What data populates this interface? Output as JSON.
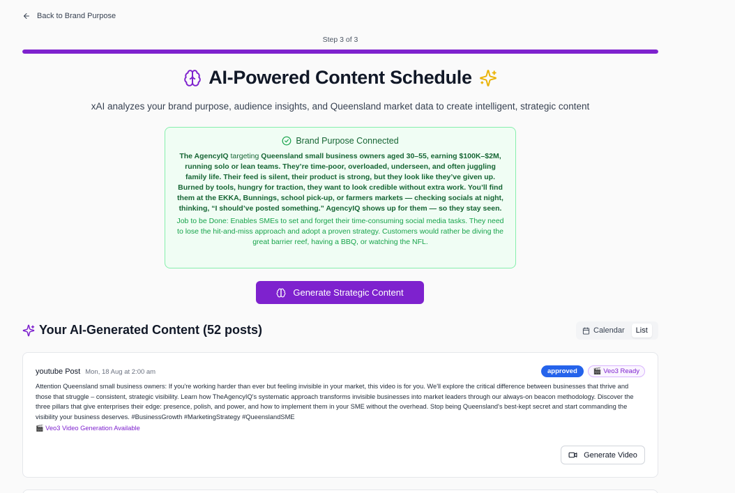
{
  "nav": {
    "back_label": "Back to Brand Purpose"
  },
  "progress": {
    "label": "Step 3 of 3",
    "fraction": 1.0,
    "color": "#7e22ce"
  },
  "hero": {
    "title": "AI-Powered Content Schedule",
    "subtitle": "xAI analyzes your brand purpose, audience insights, and Queensland market data to create intelligent, strategic content",
    "title_icon": "brain-icon",
    "sparkle_icon": "sparkles-icon"
  },
  "brand_purpose": {
    "heading": "Brand Purpose Connected",
    "brand_name": "The AgencyIQ",
    "targeting_word": "targeting",
    "audience": "Queensland small business owners aged 30–55, earning $100K–$2M, running solo or lean teams. They’re time-poor, overloaded, underseen, and often juggling family life. Their feed is silent, their product is strong, but they look like they’ve given up. Burned by tools, hungry for traction, they want to look credible without extra work. You’ll find them at the EKKA, Bunnings, school pick-up, or farmers markets — checking socials at night, thinking, “I should’ve posted something.” AgencyIQ shows up for them — so they stay seen.",
    "job_to_be_done": "Job to be Done: Enables SMEs to set and forget their time-consuming social media tasks. They need to lose the hit-and-miss approach and adopt a proven strategy. Customers would rather be diving the great barrier reef, having a BBQ, or watching the NFL."
  },
  "actions": {
    "generate_label": "Generate Strategic Content"
  },
  "content_section": {
    "title": "Your AI-Generated Content (52 posts)",
    "views": [
      {
        "label": "Calendar",
        "active": false
      },
      {
        "label": "List",
        "active": true
      }
    ]
  },
  "posts": [
    {
      "type": "youtube Post",
      "date": "Mon, 18 Aug at 2:00 am",
      "status": "approved",
      "veo_badge": "🎬 Veo3 Ready",
      "text": "Attention Queensland small business owners: If you're working harder than ever but feeling invisible in your market, this video is for you. We'll explore the critical difference between businesses that thrive and those that struggle – consistent, strategic visibility. Learn how TheAgencyIQ's systematic approach transforms invisible businesses into market leaders through our always-on beacon methodology. Discover the three pillars that give enterprises their edge: presence, polish, and power, and how to implement them in your SME without the overhead. Stop being Queensland's best-kept secret and start commanding the visibility your business deserves. #BusinessGrowth #MarketingStrategy #QueenslandSME",
      "veo_prefix": "🎬",
      "veo_note": "Veo3 Video Generation Available",
      "video_button": "Generate Video"
    }
  ]
}
